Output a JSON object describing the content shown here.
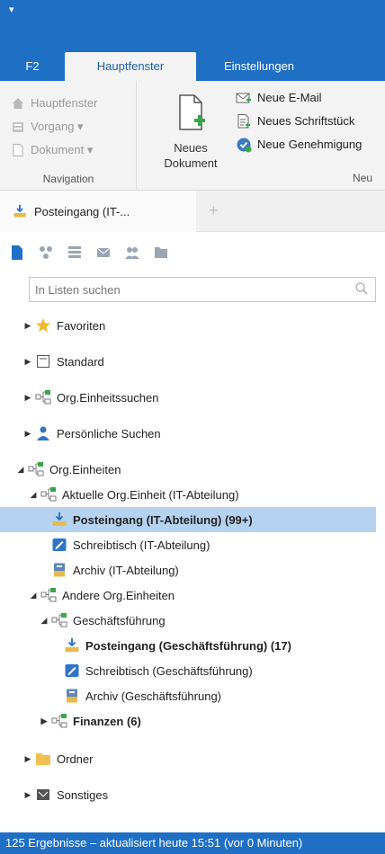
{
  "ribbon": {
    "tabs": [
      {
        "label": "F2"
      },
      {
        "label": "Hauptfenster"
      },
      {
        "label": "Einstellungen"
      }
    ],
    "navigation": {
      "items": [
        {
          "label": "Hauptfenster",
          "icon": "house-icon"
        },
        {
          "label": "Vorgang ▾",
          "icon": "folder-stack-icon"
        },
        {
          "label": "Dokument ▾",
          "icon": "document-icon"
        }
      ],
      "group_label": "Navigation"
    },
    "new_document": {
      "line1": "Neues",
      "line2": "Dokument"
    },
    "actions": [
      {
        "label": "Neue E-Mail",
        "icon": "new-mail-icon"
      },
      {
        "label": "Neues Schriftstück",
        "icon": "new-letter-icon"
      },
      {
        "label": "Neue Genehmigung",
        "icon": "approval-icon"
      }
    ],
    "actions_group_label": "Neu"
  },
  "tabstrip": {
    "active_tab": "Posteingang (IT-...",
    "add": "+"
  },
  "search": {
    "placeholder": "In Listen suchen"
  },
  "tree": [
    {
      "label": "Favoriten",
      "toggle": "▶",
      "icon": "star-icon",
      "bold": false
    },
    {
      "label": "Standard",
      "toggle": "▶",
      "icon": "standard-list-icon",
      "bold": false
    },
    {
      "label": "Org.Einheitssuchen",
      "toggle": "▶",
      "icon": "org-unit-icon",
      "bold": false
    },
    {
      "label": "Persönliche Suchen",
      "toggle": "▶",
      "icon": "person-icon",
      "bold": false
    },
    {
      "label": "Org.Einheiten",
      "toggle": "◢",
      "icon": "org-unit-icon",
      "bold": false
    },
    {
      "label": "Aktuelle Org.Einheit (IT-Abteilung)",
      "toggle": "◢",
      "icon": "org-unit-icon",
      "bold": false
    },
    {
      "label": "Posteingang (IT-Abteilung) (99+)",
      "toggle": "",
      "icon": "inbox-icon",
      "bold": true
    },
    {
      "label": "Schreibtisch (IT-Abteilung)",
      "toggle": "",
      "icon": "desk-icon",
      "bold": false
    },
    {
      "label": "Archiv (IT-Abteilung)",
      "toggle": "",
      "icon": "archive-icon",
      "bold": false
    },
    {
      "label": "Andere Org.Einheiten",
      "toggle": "◢",
      "icon": "org-unit-icon",
      "bold": false
    },
    {
      "label": "Geschäftsführung",
      "toggle": "◢",
      "icon": "org-unit-icon",
      "bold": false
    },
    {
      "label": "Posteingang (Geschäftsführung) (17)",
      "toggle": "",
      "icon": "inbox-icon",
      "bold": true
    },
    {
      "label": "Schreibtisch (Geschäftsführung)",
      "toggle": "",
      "icon": "desk-icon",
      "bold": false
    },
    {
      "label": "Archiv (Geschäftsführung)",
      "toggle": "",
      "icon": "archive-icon",
      "bold": false
    },
    {
      "label": "Finanzen (6)",
      "toggle": "▶",
      "icon": "org-unit-icon",
      "bold": true
    },
    {
      "label": "Ordner",
      "toggle": "▶",
      "icon": "folder-icon",
      "bold": false
    },
    {
      "label": "Sonstiges",
      "toggle": "▶",
      "icon": "misc-icon",
      "bold": false
    }
  ],
  "statusbar": {
    "text": "125 Ergebnisse – aktualisiert heute 15:51 (vor 0 Minuten)"
  },
  "colors": {
    "accent": "#1f6fc5",
    "selection": "#b5d3f0",
    "ribbon_bg": "#f3f3f3"
  }
}
